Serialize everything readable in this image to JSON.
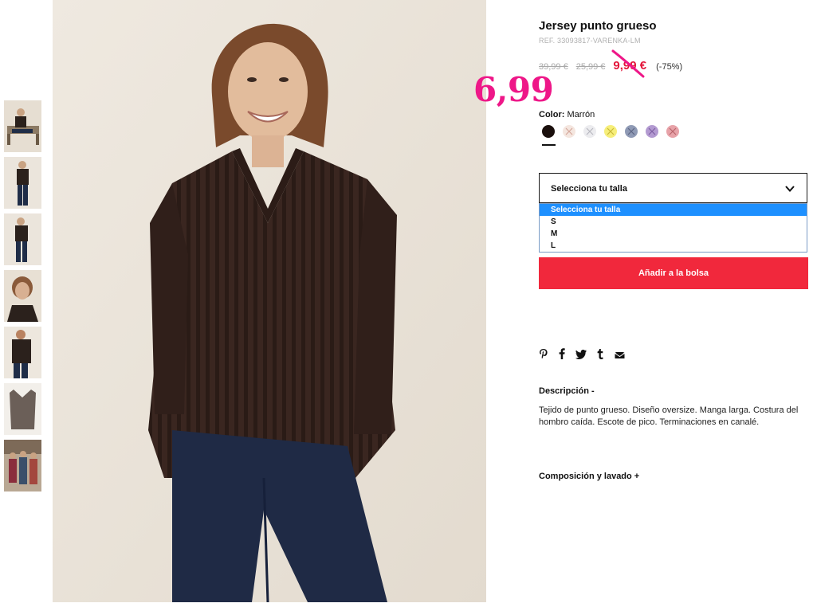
{
  "product": {
    "title": "Jersey punto grueso",
    "ref": "REF. 33093817-VARENKA-LM",
    "prices": {
      "original": "39,99 €",
      "previous": "25,99 €",
      "sale": "9,99 €",
      "discount": "(-75%)"
    },
    "handwritten_price": "6,99",
    "color": {
      "label": "Color:",
      "value": "Marrón",
      "swatches": [
        {
          "name": "brown-dark",
          "hex": "#1a0f0c",
          "available": true
        },
        {
          "name": "peach",
          "hex": "#f4e6df",
          "available": false
        },
        {
          "name": "light-grey",
          "hex": "#ececef",
          "available": false
        },
        {
          "name": "yellow",
          "hex": "#f6ee7a",
          "available": false
        },
        {
          "name": "blue-grey",
          "hex": "#8f9ab5",
          "available": false
        },
        {
          "name": "purple",
          "hex": "#b39ad1",
          "available": false
        },
        {
          "name": "pink",
          "hex": "#e7a2a8",
          "available": false
        }
      ]
    },
    "size": {
      "placeholder": "Selecciona tu talla",
      "options": [
        "Selecciona tu talla",
        "S",
        "M",
        "L"
      ],
      "selected_index": 0
    },
    "add_to_bag": "Añadir a la bolsa",
    "social": [
      "pinterest-icon",
      "facebook-icon",
      "twitter-icon",
      "tumblr-icon",
      "email-icon"
    ],
    "description": {
      "title": "Descripción -",
      "text": "Tejido de punto grueso. Diseño oversize. Manga larga. Costura del hombro caída. Escote de pico. Terminaciones en canalé."
    },
    "composition_title": "Composición y lavado +"
  },
  "colors": {
    "accent": "#f1283c",
    "sale_red": "#e3173b",
    "handwritten_pink": "#ee1788",
    "dropdown_highlight": "#1e90ff"
  }
}
